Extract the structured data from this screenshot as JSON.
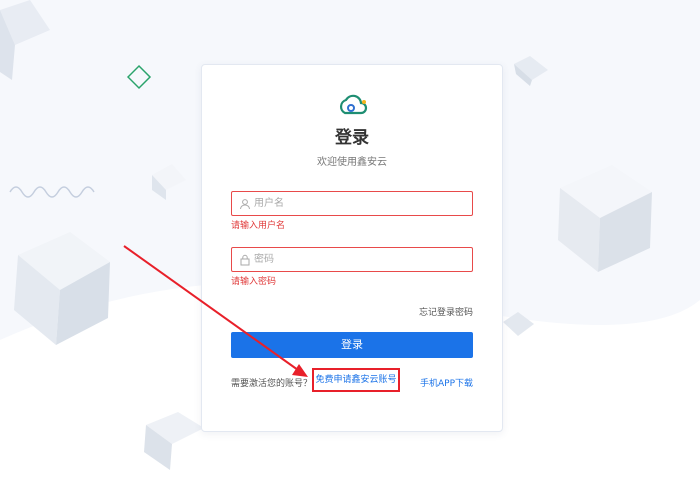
{
  "login": {
    "title": "登录",
    "subtitle": "欢迎使用鑫安云",
    "username": {
      "placeholder": "用户名",
      "value": "",
      "error": "请输入用户名"
    },
    "password": {
      "placeholder": "密码",
      "value": "",
      "error": "请输入密码"
    },
    "forgot_label": "忘记登录密码",
    "submit_label": "登录",
    "activate_text": "需要激活您的账号？",
    "apply_label": "免费申请鑫安云账号",
    "app_download_label": "手机APP下载"
  },
  "icons": {
    "logo": "cloud-logo-icon",
    "username": "user-icon",
    "password": "lock-icon"
  },
  "colors": {
    "accent": "#1b73e8",
    "error": "#e03a3a",
    "annotation": "#e8202a",
    "background": "#f6f8fc"
  }
}
